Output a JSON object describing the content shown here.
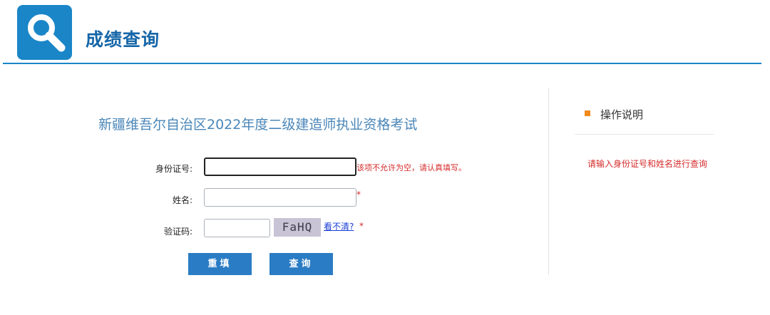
{
  "header": {
    "title": "成绩查询",
    "logo_icon": "search-icon",
    "accent": "#1a86c8"
  },
  "form": {
    "exam_title": "新疆维吾尔自治区2022年度二级建造师执业资格考试",
    "id_label": "身份证号:",
    "id_value": "",
    "id_error": "该项不允许为空，请认真填写。",
    "name_label": "姓名:",
    "name_value": "",
    "name_required": "*",
    "captcha_label": "验证码:",
    "captcha_value": "",
    "captcha_text": "FaHQ",
    "captcha_refresh": "看不清?",
    "captcha_required": "*",
    "reset_button": "重填",
    "submit_button": "查询"
  },
  "sidebar": {
    "heading": "操作说明",
    "bullet_color": "#f08a1c",
    "note": "请输入身份证号和姓名进行查询"
  }
}
